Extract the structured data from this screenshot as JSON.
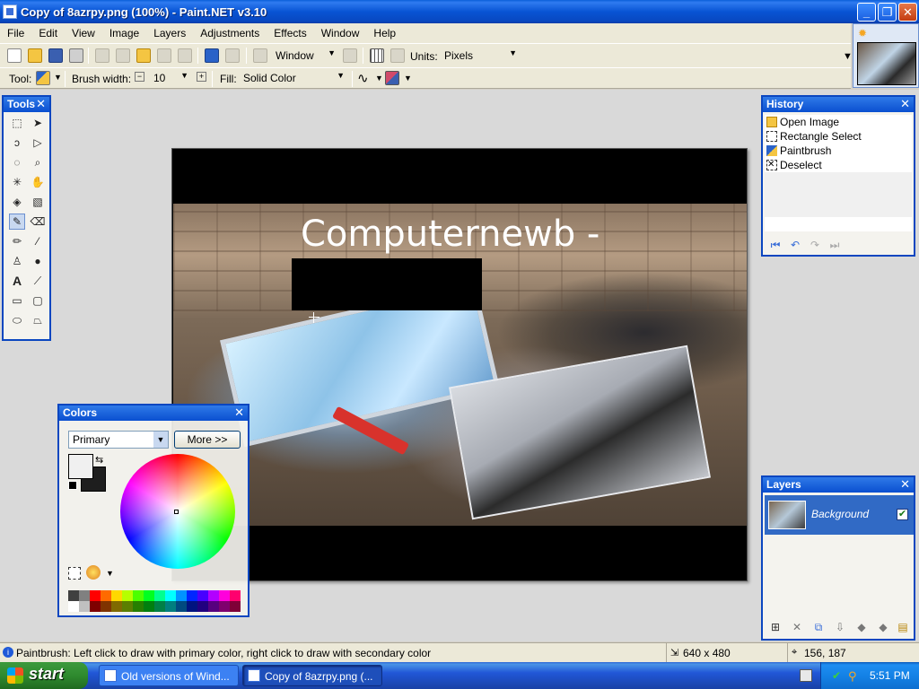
{
  "window": {
    "title": "Copy of 8azrpy.png (100%) - Paint.NET v3.10"
  },
  "menu": {
    "items": [
      "File",
      "Edit",
      "View",
      "Image",
      "Layers",
      "Adjustments",
      "Effects",
      "Window",
      "Help"
    ]
  },
  "toolbar": {
    "zoom_value": "Window",
    "units_label": "Units:",
    "units_value": "Pixels",
    "tool_label": "Tool:",
    "brush_width_label": "Brush width:",
    "brush_width_value": "10",
    "fill_label": "Fill:",
    "fill_value": "Solid Color"
  },
  "tools_panel": {
    "title": "Tools"
  },
  "canvas": {
    "overlay_text": "Computernewb -"
  },
  "history_panel": {
    "title": "History",
    "items": [
      "Open Image",
      "Rectangle Select",
      "Paintbrush",
      "Deselect"
    ]
  },
  "layers_panel": {
    "title": "Layers",
    "layer_name": "Background"
  },
  "colors_panel": {
    "title": "Colors",
    "mode_value": "Primary",
    "more_button": "More >>",
    "primary_color": "#f0f0f0",
    "secondary_color": "#1e1e1e",
    "palette": [
      "#404040",
      "#808080",
      "#ff0000",
      "#ff6a00",
      "#ffd800",
      "#b6ff00",
      "#4cff00",
      "#00ff21",
      "#00ff90",
      "#00ffff",
      "#0094ff",
      "#0026ff",
      "#4800ff",
      "#b200ff",
      "#ff00dc",
      "#ff006e",
      "#ffffff",
      "#c0c0c0",
      "#7f0000",
      "#7f3300",
      "#7f6a00",
      "#5b7f00",
      "#267f00",
      "#007f0e",
      "#007f46",
      "#007f7f",
      "#004a7f",
      "#00137f",
      "#21007f",
      "#57007f",
      "#7f006e",
      "#7f0037"
    ]
  },
  "statusbar": {
    "message": "Paintbrush: Left click to draw with primary color, right click to draw with secondary color",
    "image_size": "640 x 480",
    "cursor_position": "156, 187"
  },
  "taskbar": {
    "start_label": "start",
    "tasks": [
      "Old versions of Wind...",
      "Copy of 8azrpy.png (..."
    ],
    "clock": "5:51 PM"
  },
  "colors": {
    "titlebar": "#0a4fd0",
    "panel_border": "#0a46c0",
    "selection": "#316ac5"
  }
}
